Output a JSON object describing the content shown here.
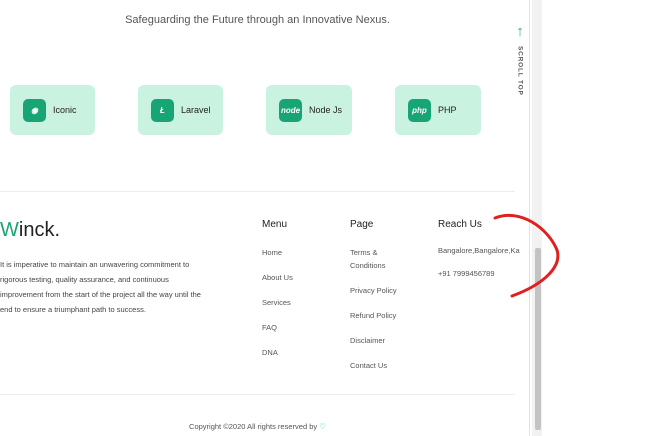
{
  "header": {
    "tagline": "Safeguarding the Future through an Innovative Nexus."
  },
  "scroll_top": {
    "label": "SCROLL TOP",
    "icon": "arrow-up-icon"
  },
  "technologies": [
    {
      "name": "Iconic",
      "icon": "ionic-icon",
      "glyph": "◉"
    },
    {
      "name": "Laravel",
      "icon": "laravel-icon",
      "glyph": "Ł"
    },
    {
      "name": "Node Js",
      "icon": "nodejs-icon",
      "glyph": "node"
    },
    {
      "name": "PHP",
      "icon": "php-icon",
      "glyph": "php"
    }
  ],
  "footer": {
    "logo_first": "W",
    "logo_rest": "inck.",
    "about": "It is imperative to maintain an unwavering commitment to rigorous testing, quality assurance, and continuous improvement from the start of the project all the way until the end to ensure a triumphant path to success.",
    "menu": {
      "title": "Menu",
      "items": [
        "Home",
        "About Us",
        "Services",
        "FAQ",
        "DNA"
      ]
    },
    "page": {
      "title": "Page",
      "items": [
        "Terms & Conditions",
        "Privacy Policy",
        "Refund Policy",
        "Disclaimer",
        "Contact Us"
      ]
    },
    "reach": {
      "title": "Reach Us",
      "address": "Bangalore,Bangalore,Ka",
      "phone": "+91 7999456789"
    },
    "copyright": "Copyright ©2020 All rights reserved by",
    "heart": "♡"
  },
  "colors": {
    "accent": "#18a576",
    "tile": "#c9f2e0",
    "annotation": "#e0201f"
  }
}
